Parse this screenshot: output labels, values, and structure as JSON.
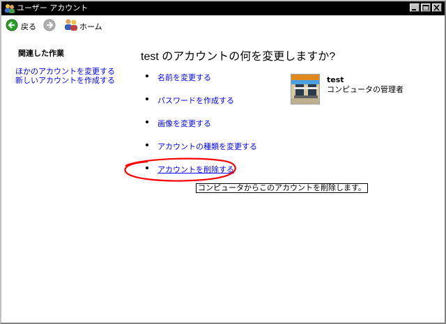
{
  "window": {
    "title": "ユーザー アカウント"
  },
  "nav": {
    "back_label": "戻る",
    "home_label": "ホーム"
  },
  "sidebar": {
    "heading": "関連した作業",
    "links": [
      "ほかのアカウントを変更する",
      "新しいアカウントを作成する"
    ]
  },
  "main": {
    "title": "test のアカウントの何を変更しますか?",
    "tasks": [
      "名前を変更する",
      "パスワードを作成する",
      "画像を変更する",
      "アカウントの種類を変更する",
      "アカウントを削除する"
    ],
    "tooltip": "コンピュータからこのアカウントを削除します。"
  },
  "account": {
    "name": "test",
    "role": "コンピュータの管理者"
  },
  "colors": {
    "link": "#0000ff",
    "annotation": "#ff0000",
    "titlebar": "#000000"
  }
}
